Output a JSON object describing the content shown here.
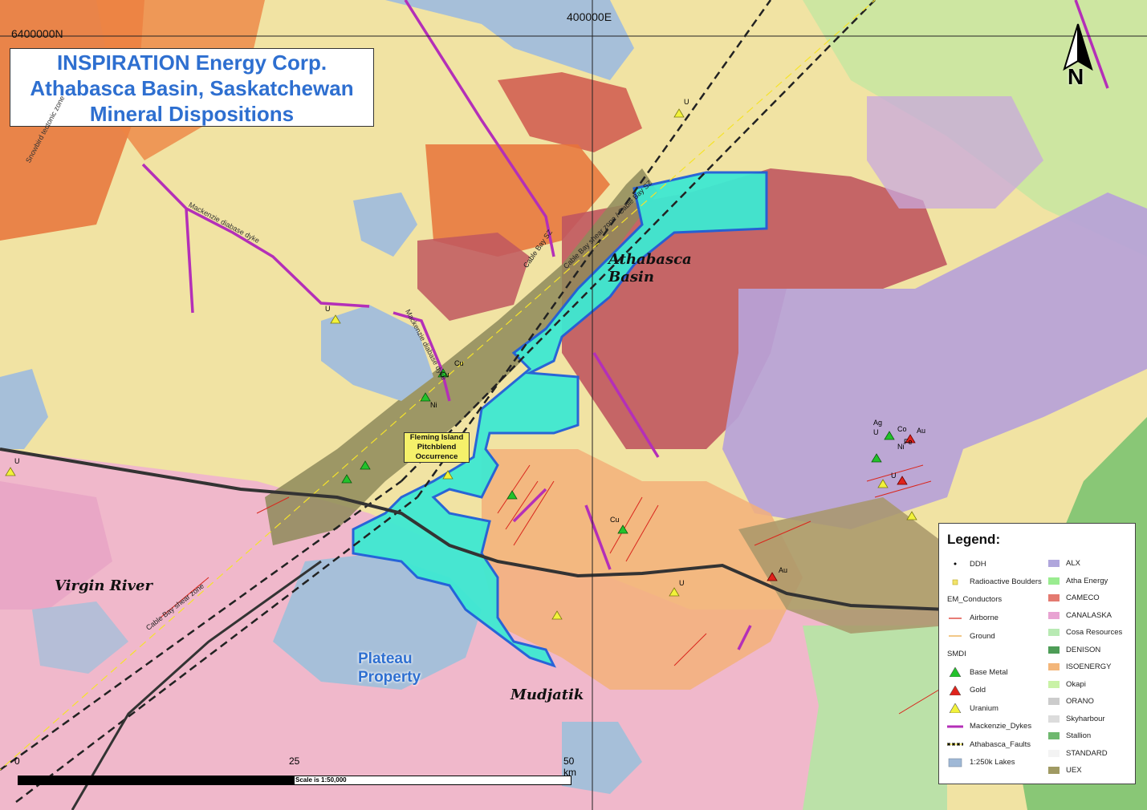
{
  "title": {
    "line1": "INSPIRATION Energy Corp.",
    "line2": "Athabasca Basin, Saskatchewan",
    "line3": "Mineral Dispositions"
  },
  "grid": {
    "northing": "6400000N",
    "easting": "400000E"
  },
  "north_arrow": {
    "letter": "N"
  },
  "labels": {
    "athabasca_basin": "Athabasca Basin",
    "virgin_river": "Virgin River",
    "mudjatik": "Mudjatik",
    "plateau_property": "Plateau Property",
    "fleming_island": "Fleming Island Pitchblend Occurrence",
    "cable_bay_sz": "Cable Bay shear zone",
    "cable_bay_sz_ne": "Cable Bay shear zone / Cable Bay SZ",
    "cable_bay_sz_short": "Cable Bay SZ",
    "mackenzie_dyke_1": "Mackenzie diabase dyke",
    "mackenzie_dyke_2": "Mackenzie diabase dyke",
    "snowbird_tectonic": "Snowbird tectonic zone"
  },
  "occurrence_labels": [
    "U",
    "U",
    "U",
    "U",
    "U",
    "Cu",
    "Cu",
    "Ni",
    "Ag",
    "Au",
    "Au",
    "Co",
    "Ni",
    "U",
    "Cu",
    "Fe"
  ],
  "scale_bar": {
    "ticks": [
      "0",
      "25",
      "50 km"
    ],
    "text": "Scale is 1:50,000"
  },
  "legend": {
    "title": "Legend:",
    "left": [
      {
        "label": "DDH",
        "symbol": "dot",
        "color": "#000000"
      },
      {
        "label": "Radioactive Boulders",
        "symbol": "square",
        "color": "#f2e36b"
      },
      {
        "label": "EM_Conductors",
        "symbol": "header"
      },
      {
        "label": "Airborne",
        "symbol": "line",
        "color": "#d9261c"
      },
      {
        "label": "Ground",
        "symbol": "line",
        "color": "#e8a33a"
      },
      {
        "label": "SMDI",
        "symbol": "header"
      },
      {
        "label": "Base Metal",
        "symbol": "triangle",
        "color": "#22c22b"
      },
      {
        "label": "Gold",
        "symbol": "triangle",
        "color": "#e0231c"
      },
      {
        "label": "Uranium",
        "symbol": "triangle",
        "color": "#f2f23a"
      },
      {
        "label": "Mackenzie_Dykes",
        "symbol": "thickline",
        "color": "#b42fb8"
      },
      {
        "label": "Athabasca_Faults",
        "symbol": "dashline",
        "color": "#f5e32a"
      },
      {
        "label": "1:250k Lakes",
        "symbol": "swatch",
        "color": "#9fb8d6"
      }
    ],
    "right": [
      {
        "label": "ALX",
        "color": "#b0a6dc"
      },
      {
        "label": "Atha Energy",
        "color": "#9aec90"
      },
      {
        "label": "CAMECO",
        "color": "#e47a70"
      },
      {
        "label": "CANALASKA",
        "color": "#e8a3d2"
      },
      {
        "label": "Cosa Resources",
        "color": "#b8eab3"
      },
      {
        "label": "DENISON",
        "color": "#4e9d57"
      },
      {
        "label": "ISOENERGY",
        "color": "#f3b67a"
      },
      {
        "label": "Okapi",
        "color": "#c9f2a6"
      },
      {
        "label": "ORANO",
        "color": "#cccccc"
      },
      {
        "label": "Skyharbour",
        "color": "#dcdcdc"
      },
      {
        "label": "Stallion",
        "color": "#6fb86f"
      },
      {
        "label": "STANDARD",
        "color": "#f3f3f3"
      },
      {
        "label": "UEX",
        "color": "#a09a63"
      }
    ]
  },
  "colors": {
    "property": "#3ee9d2",
    "property_outline": "#1f5fd9",
    "title_text": "#2e6fd0",
    "label_text": "#2e6fd0"
  }
}
